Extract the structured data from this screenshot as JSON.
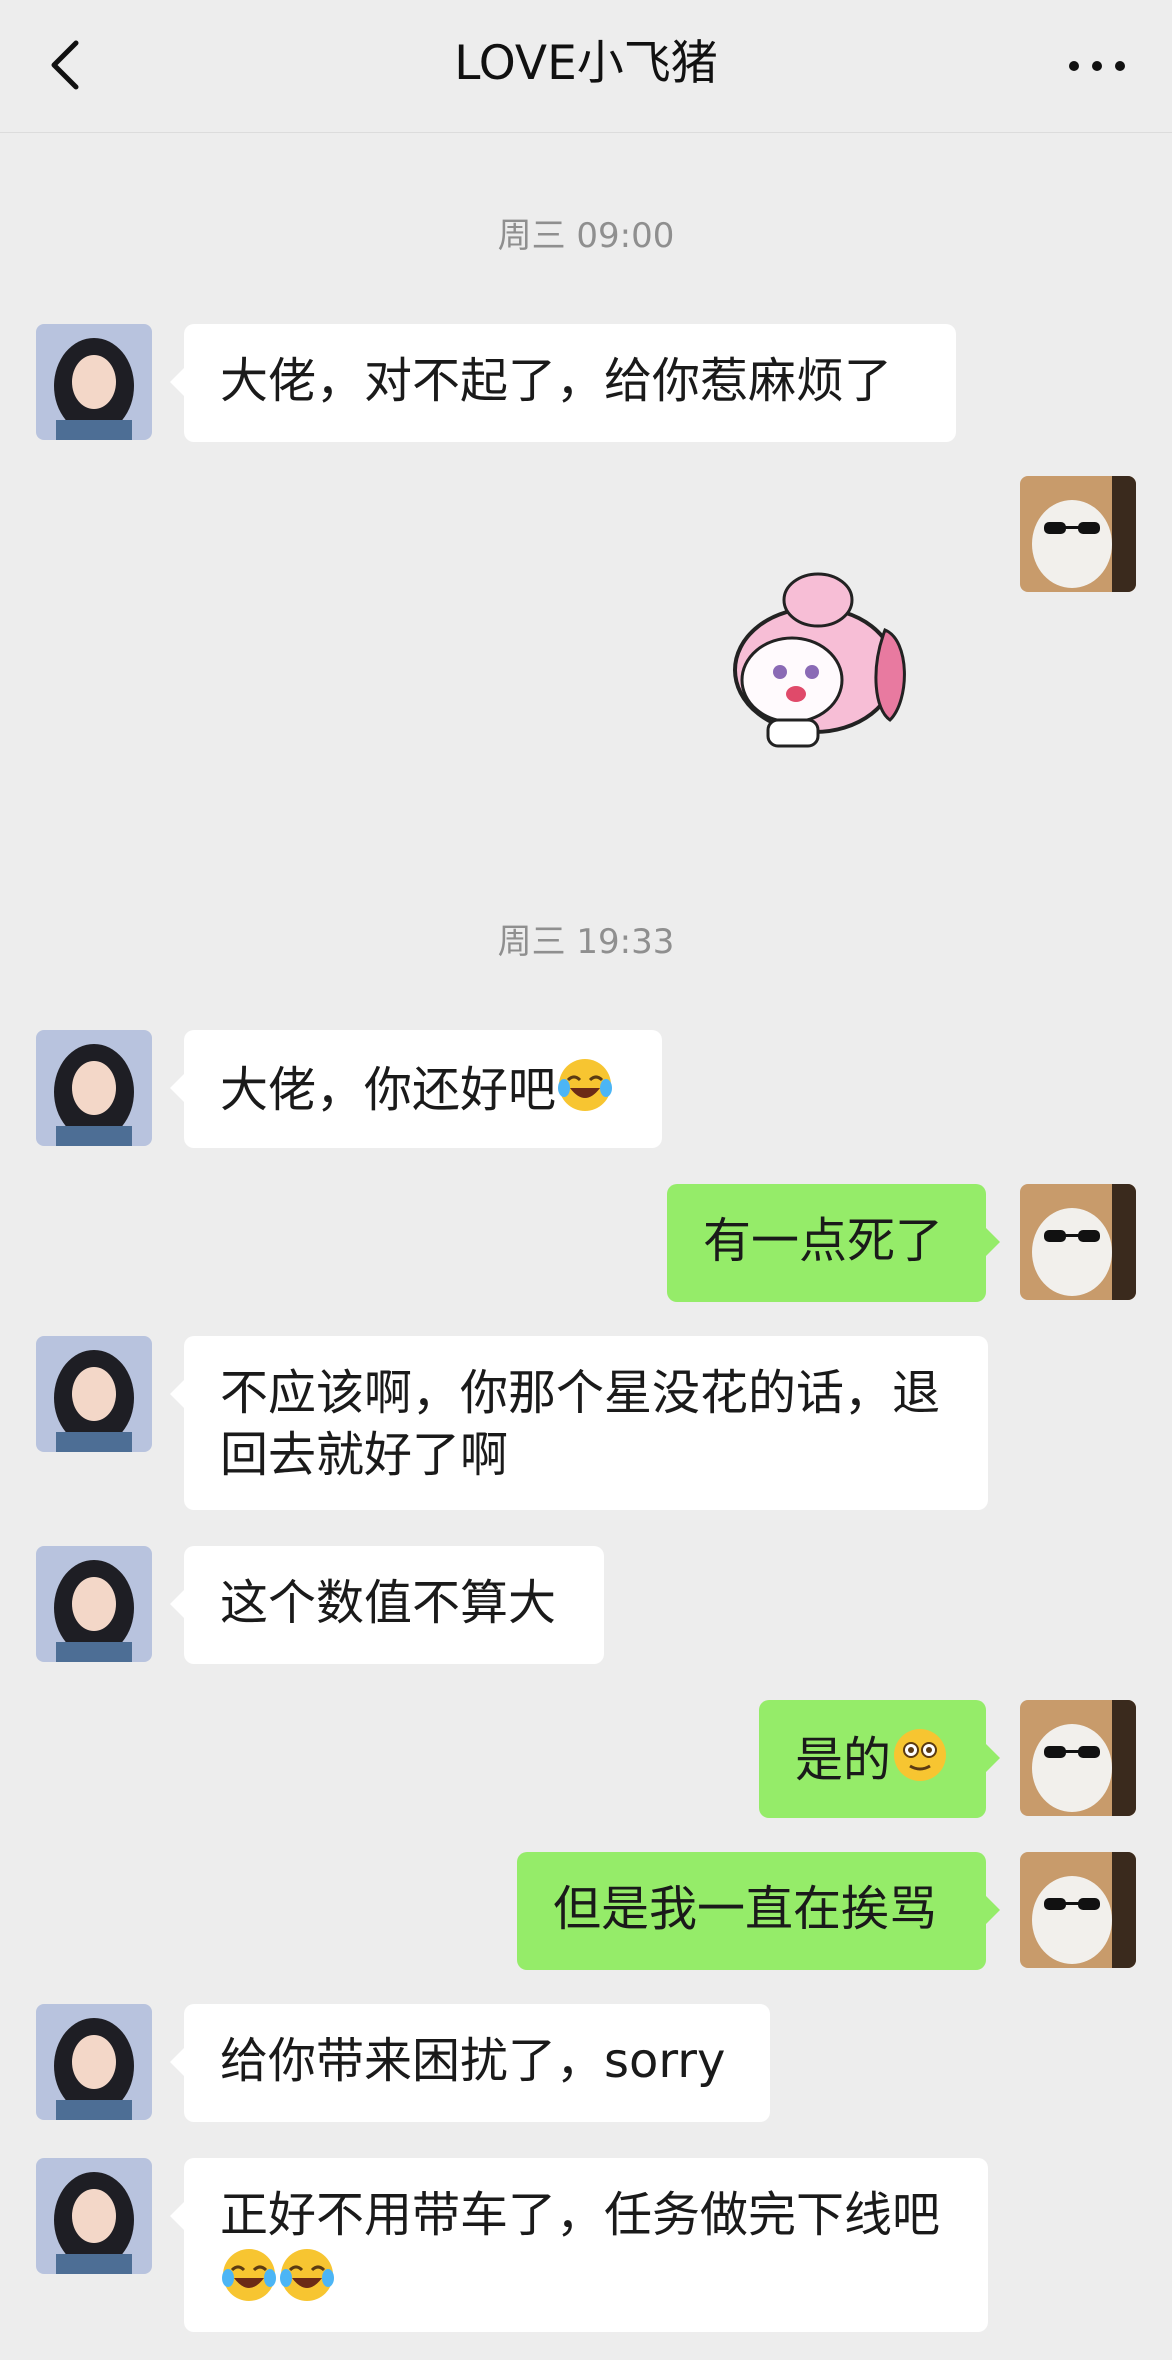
{
  "header": {
    "title": "LOVE小飞猪",
    "back_icon": "chevron-left-icon",
    "more_icon": "more-dots-icon"
  },
  "timestamps": [
    "周三 09:00",
    "周三 19:33"
  ],
  "messages": [
    {
      "side": "in",
      "text": "大佬，对不起了，给你惹麻烦了"
    },
    {
      "side": "out",
      "type": "sticker",
      "sticker": "pink-hair-anime-sticker"
    },
    {
      "side": "in",
      "text": "大佬，你还好吧",
      "emoji": [
        "tears-of-joy-emoji"
      ]
    },
    {
      "side": "out",
      "text": "有一点死了"
    },
    {
      "side": "in",
      "lines": [
        "不应该啊，你那个星没花的话，退",
        "回去就好了啊"
      ]
    },
    {
      "side": "in",
      "text": "这个数值不算大"
    },
    {
      "side": "out",
      "text": "是的",
      "emoji": [
        "flushed-smile-emoji"
      ]
    },
    {
      "side": "out",
      "text": "但是我一直在挨骂"
    },
    {
      "side": "in",
      "text": "给你带来困扰了，sorry"
    },
    {
      "side": "in",
      "lines": [
        "正好不用带车了，任务做完下线吧"
      ],
      "emoji": [
        "tears-of-joy-emoji",
        "tears-of-joy-emoji"
      ]
    }
  ],
  "colors": {
    "background": "#ededed",
    "incoming_bubble": "#ffffff",
    "outgoing_bubble": "#95ec69",
    "timestamp": "#8f8f8f"
  }
}
